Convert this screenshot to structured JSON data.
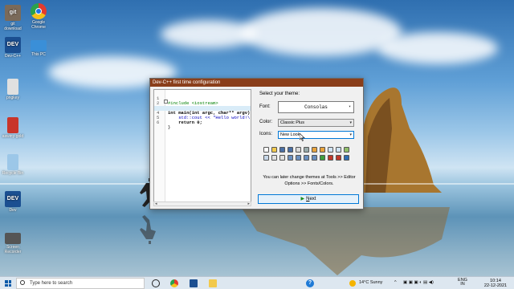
{
  "desktop": {
    "icons": [
      {
        "name": "git-download",
        "label": "git\ndownload",
        "color": "#7a6a5a"
      },
      {
        "name": "google-chrome",
        "label": "Google Chrome",
        "color": "#e33b2e"
      },
      {
        "name": "dev-cpp",
        "label": "Dev-C++",
        "color": "#1b4f91"
      },
      {
        "name": "this-pc",
        "label": "This PC",
        "color": "#3a8fd8"
      },
      {
        "name": "pngkey",
        "label": "pngkey",
        "color": "#e0e0e0"
      },
      {
        "name": "aswiny-gold",
        "label": "aswiny-gold",
        "color": "#c8352b"
      },
      {
        "name": "recycle-bin",
        "label": "Recycle Bin",
        "color": "#9cc7e8"
      },
      {
        "name": "dev-cpp-2",
        "label": "Dev",
        "color": "#1b4f91"
      },
      {
        "name": "screen-recorder",
        "label": "Screen Recorder",
        "color": "#555"
      }
    ]
  },
  "dialog": {
    "title": "Dev-C++ first time configuration",
    "code_lines": [
      {
        "n": "1",
        "text": "#include <iostream>",
        "kind": "pp"
      },
      {
        "n": "2",
        "text": "",
        "kind": ""
      },
      {
        "n": "3",
        "text": "int main(int argc, char** argv)",
        "kind": "kw"
      },
      {
        "n": "4",
        "text": "    std::cout << \"Hello world!\\",
        "kind": "str"
      },
      {
        "n": "5",
        "text": "    return 0;",
        "kind": "kw"
      },
      {
        "n": "6",
        "text": "}",
        "kind": ""
      }
    ],
    "theme_heading": "Select your theme:",
    "font_label": "Font:",
    "font_value": "Consolas",
    "color_label": "Color:",
    "color_value": "Classic Plus",
    "icons_label": "Icons:",
    "icons_value": "New Look",
    "note": "You can later change themes at Tools >> Editor Options >> Fonts/Colors.",
    "next_label": "Next",
    "next_underlined": "N",
    "next_rest": "ext"
  },
  "taskbar": {
    "search_placeholder": "Type here to search",
    "weather": "14°C  Sunny",
    "lang_top": "ENG",
    "lang_bottom": "IN",
    "time": "10:14",
    "date": "22-12-2021"
  },
  "colors": {
    "titlebar": "#8a3e1a",
    "next_border": "#0078d7",
    "taskbar": "#dde7f0"
  }
}
